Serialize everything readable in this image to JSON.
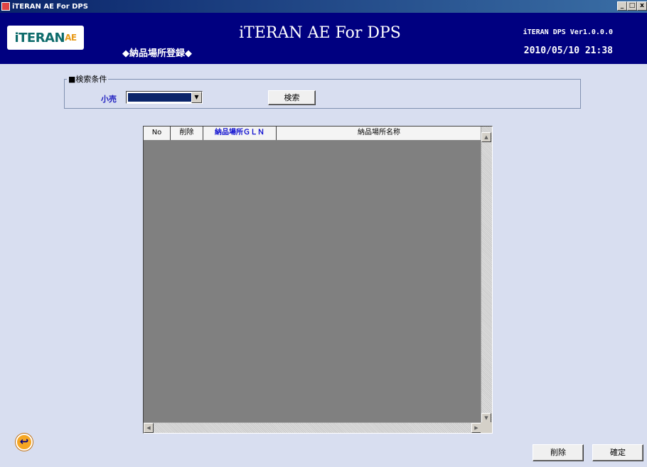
{
  "window": {
    "title": "iTERAN AE For DPS",
    "minimize": "_",
    "maximize": "□",
    "close": "x"
  },
  "header": {
    "logo_main": "iTERAN",
    "logo_suffix": "AE",
    "app_title": "iTERAN AE For DPS",
    "screen_title": "◆納品場所登録◆",
    "version": "iTERAN DPS Ver1.0.0.0",
    "datetime": "2010/05/10 21:38"
  },
  "search": {
    "group_title": "■検索条件",
    "retail_label": "小売",
    "retail_selected": "",
    "search_button": "検索"
  },
  "grid": {
    "columns": [
      "No",
      "削除",
      "納品場所ＧＬＮ",
      "納品場所名称"
    ],
    "rows": []
  },
  "footer": {
    "back_icon": "↩",
    "delete_button": "削除",
    "confirm_button": "確定"
  },
  "colors": {
    "header_bg": "#000080",
    "body_bg": "#d8def0",
    "grid_bg": "#808080",
    "key_column": "#1010d0"
  }
}
